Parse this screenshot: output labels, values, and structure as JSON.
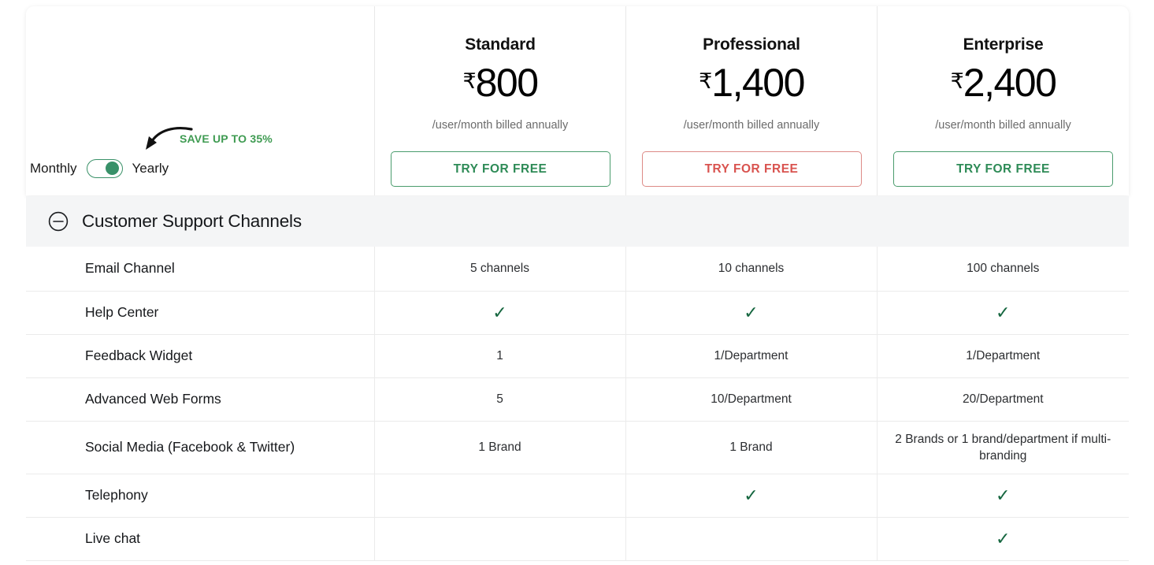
{
  "billing_toggle": {
    "monthly_label": "Monthly",
    "yearly_label": "Yearly",
    "save_badge": "SAVE UP TO 35%",
    "selected": "Yearly"
  },
  "plans": [
    {
      "name": "Standard",
      "currency": "₹",
      "amount": "800",
      "billing_note": "/user/month billed annually",
      "cta_label": "TRY FOR FREE",
      "cta_color": "#2e8b57"
    },
    {
      "name": "Professional",
      "currency": "₹",
      "amount": "1,400",
      "billing_note": "/user/month billed annually",
      "cta_label": "TRY FOR FREE",
      "cta_color": "#d9534f"
    },
    {
      "name": "Enterprise",
      "currency": "₹",
      "amount": "2,400",
      "billing_note": "/user/month billed annually",
      "cta_label": "TRY FOR FREE",
      "cta_color": "#2e8b57"
    }
  ],
  "section": {
    "title": "Customer Support Channels",
    "collapse_icon": "circle-minus-icon",
    "expanded": true
  },
  "features": [
    {
      "label": "Email Channel",
      "standard": "5 channels",
      "professional": "10 channels",
      "enterprise": "100 channels"
    },
    {
      "label": "Help Center",
      "standard": "✓",
      "professional": "✓",
      "enterprise": "✓"
    },
    {
      "label": "Feedback Widget",
      "standard": "1",
      "professional": "1/Department",
      "enterprise": "1/Department"
    },
    {
      "label": "Advanced Web Forms",
      "standard": "5",
      "professional": "10/Department",
      "enterprise": "20/Department"
    },
    {
      "label": "Social Media (Facebook & Twitter)",
      "standard": "1 Brand",
      "professional": "1 Brand",
      "enterprise": "2 Brands or 1 brand/department if multi-branding"
    },
    {
      "label": "Telephony",
      "standard": "",
      "professional": "✓",
      "enterprise": "✓"
    },
    {
      "label": "Live chat",
      "standard": "",
      "professional": "",
      "enterprise": "✓"
    }
  ],
  "colors": {
    "accent_green": "#2e8b57",
    "accent_red": "#d9534f",
    "check_green": "#15663f",
    "save_green": "#3f9b52",
    "section_bg": "#f4f5f6"
  }
}
